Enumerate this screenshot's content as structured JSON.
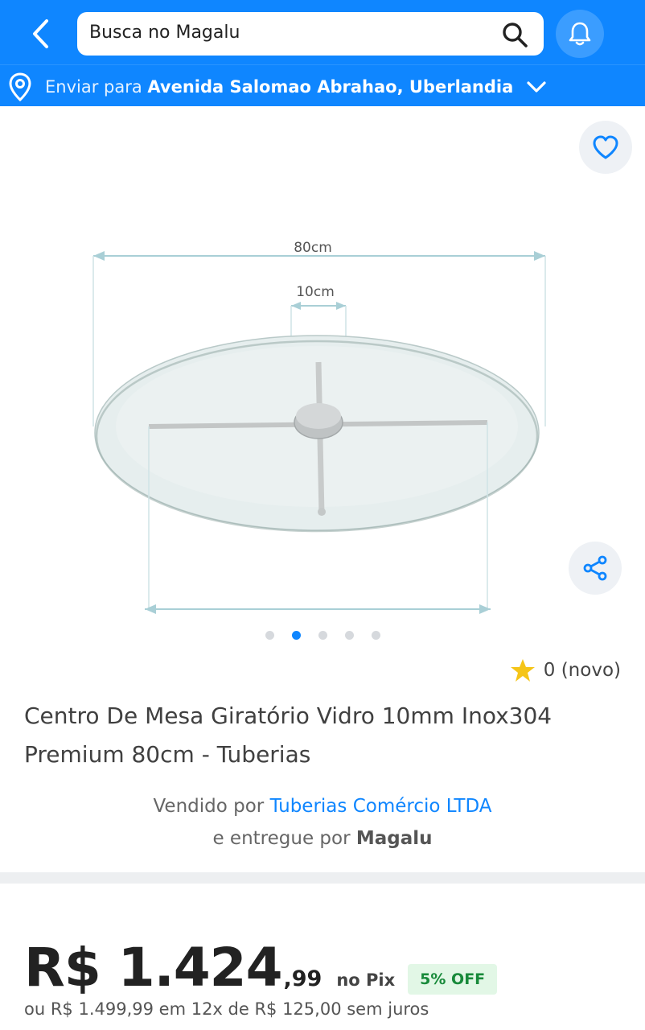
{
  "header": {
    "search_placeholder": "Busca no Magalu",
    "address_prefix": "Enviar para",
    "address_value": "Avenida Salomao Abrahao, Uberlandia",
    "accent": "#0f86ff"
  },
  "icons": [
    "back-arrow-icon",
    "search-icon",
    "bell-icon",
    "location-pin-icon",
    "chevron-down-icon",
    "heart-icon",
    "share-icon",
    "star-icon"
  ],
  "product_image": {
    "dimension_outer": "80cm",
    "dimension_inner": "10cm"
  },
  "carousel": {
    "count": 5,
    "active_index": 1
  },
  "rating": {
    "text": "0 (novo)"
  },
  "product": {
    "title": "Centro De Mesa Giratório Vidro 10mm Inox304 Premium 80cm - Tuberias"
  },
  "seller": {
    "sold_by_label": "Vendido por",
    "sold_by_name": "Tuberias Comércio LTDA",
    "delivered_by_label": "e entregue por",
    "delivered_by_name": "Magalu"
  },
  "price": {
    "main": "R$ 1.424",
    "cents": ",99",
    "method": "no Pix",
    "discount_badge": "5% OFF",
    "installment_text": "ou R$ 1.499,99 em 12x de R$ 125,00 sem juros"
  }
}
